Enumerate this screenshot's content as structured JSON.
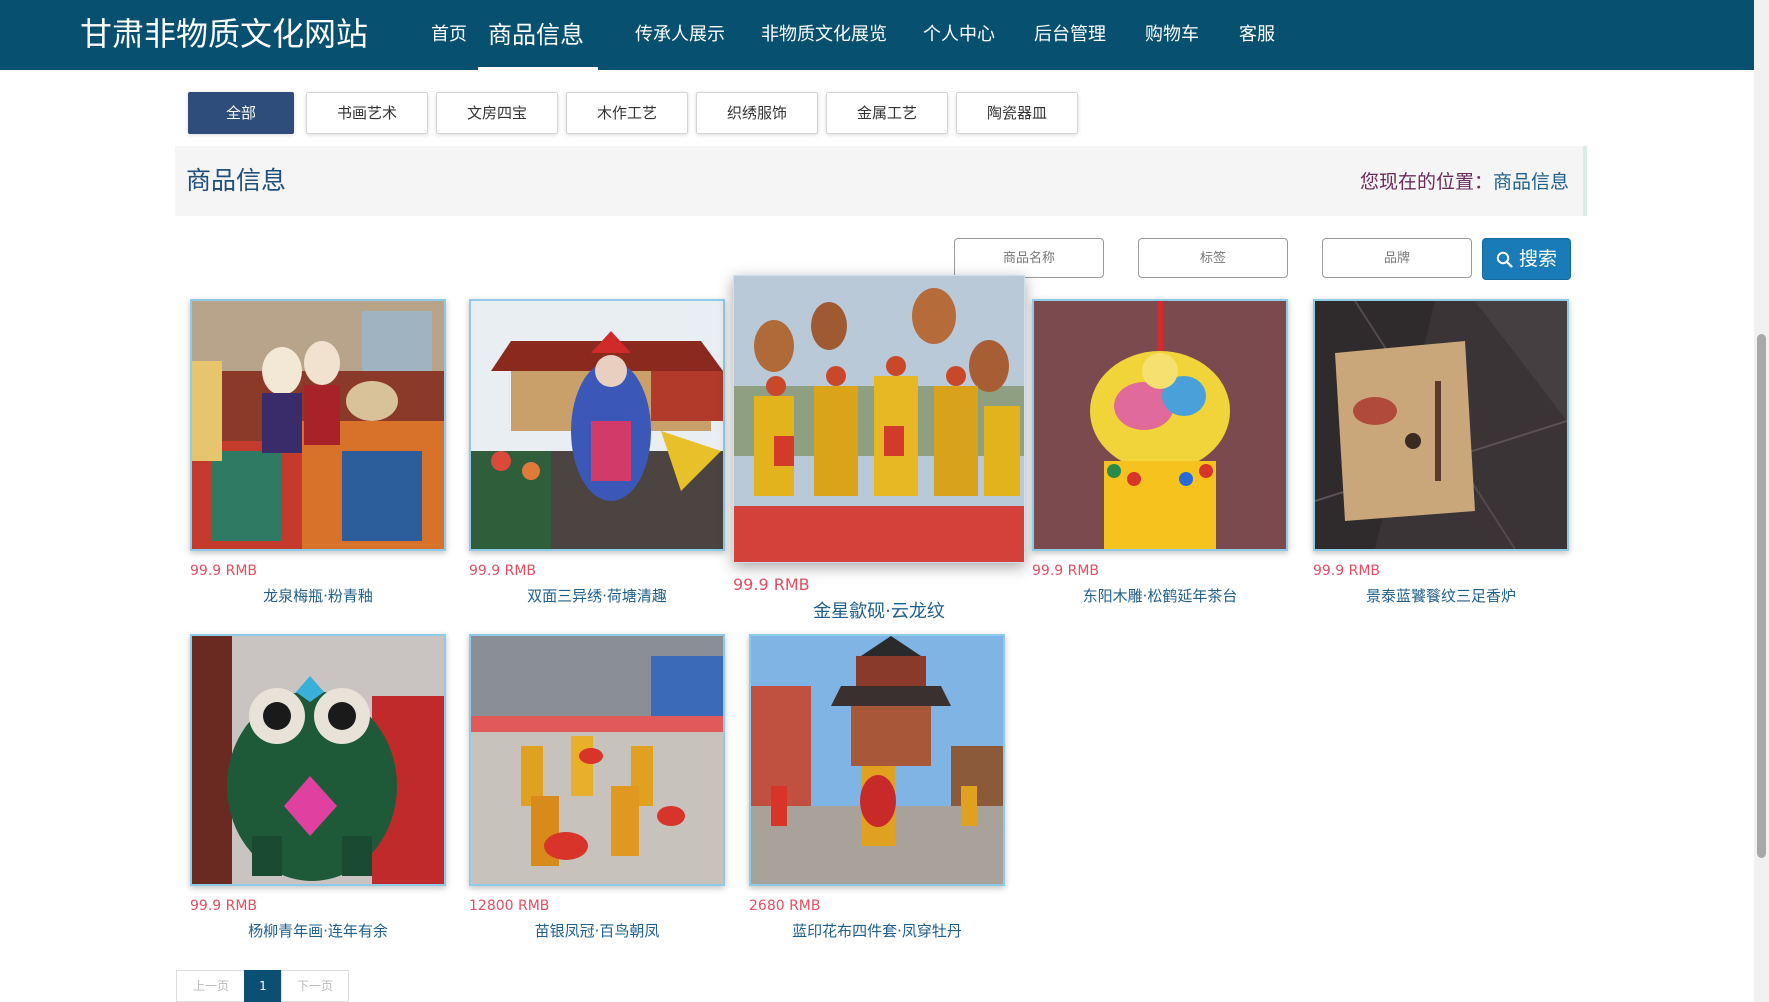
{
  "header": {
    "site_title": "甘肃非物质文化网站",
    "nav": [
      {
        "label": "首页"
      },
      {
        "label": "商品信息",
        "active": true
      },
      {
        "label": "传承人展示"
      },
      {
        "label": "非物质文化展览"
      },
      {
        "label": "个人中心"
      },
      {
        "label": "后台管理"
      },
      {
        "label": "购物车"
      },
      {
        "label": "客服"
      }
    ]
  },
  "categories": [
    {
      "label": "全部",
      "active": true
    },
    {
      "label": "书画艺术"
    },
    {
      "label": "文房四宝"
    },
    {
      "label": "木作工艺"
    },
    {
      "label": "织绣服饰"
    },
    {
      "label": "金属工艺"
    },
    {
      "label": "陶瓷器皿"
    }
  ],
  "page_heading": {
    "title": "商品信息",
    "location_label": "您现在的位置：",
    "location_current": "商品信息"
  },
  "search": {
    "name_placeholder": "商品名称",
    "tag_placeholder": "标签",
    "brand_placeholder": "品牌",
    "button_label": "搜索",
    "button_icon": "search-icon"
  },
  "products": [
    {
      "price": "99.9 RMB",
      "name": "龙泉梅瓶·粉青釉",
      "image": "dolls-textiles"
    },
    {
      "price": "99.9 RMB",
      "name": "双面三异绣·荷塘清趣",
      "image": "parade-gate"
    },
    {
      "price": "99.9 RMB",
      "name": "金星歙砚·云龙纹",
      "image": "fan-dancers"
    },
    {
      "price": "99.9 RMB",
      "name": "东阳木雕·松鹤延年茶台",
      "image": "embroidered-sachet"
    },
    {
      "price": "99.9 RMB",
      "name": "景泰蓝饕餮纹三足香炉",
      "image": "book-cover"
    },
    {
      "price": "99.9 RMB",
      "name": "杨柳青年画·连年有余",
      "image": "embroidered-tiger"
    },
    {
      "price": "12800 RMB",
      "name": "苗银凤冠·百鸟朝凤",
      "image": "drum-dancers"
    },
    {
      "price": "2680 RMB",
      "name": "蓝印花布四件套·凤穿牡丹",
      "image": "drum-tower"
    }
  ],
  "pagination": {
    "prev": "上一页",
    "current": "1",
    "next": "下一页"
  },
  "colors": {
    "header_bg": "#07506f",
    "category_active": "#2e4d7b",
    "price": "#e05064",
    "product_name": "#1f5f8b",
    "search_button": "#1a7bb9"
  }
}
